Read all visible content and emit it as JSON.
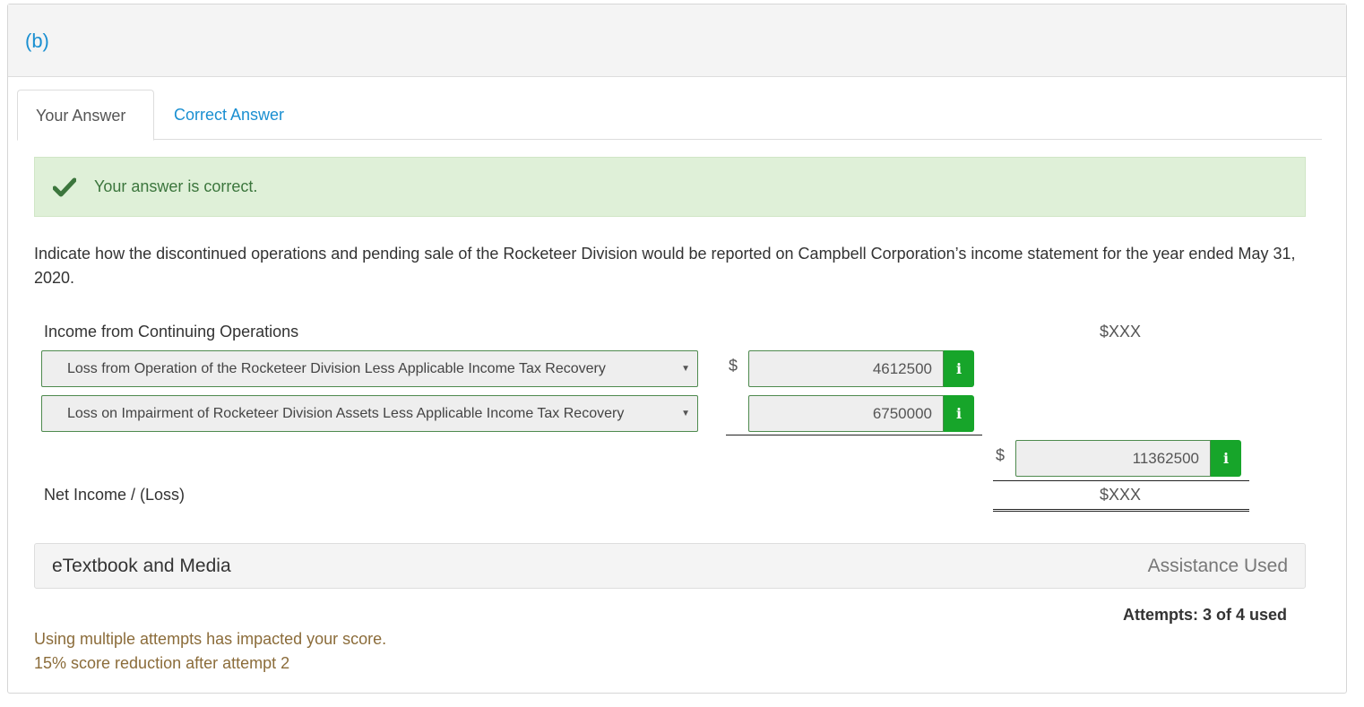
{
  "part": {
    "label": "(b)"
  },
  "tabs": [
    {
      "label": "Your Answer",
      "active": true
    },
    {
      "label": "Correct Answer",
      "active": false
    }
  ],
  "feedback": {
    "icon": "checkmark-icon",
    "message": "Your answer is correct.",
    "color": "#3c763d",
    "background": "#dff0d8"
  },
  "question": {
    "text": "Indicate how the discontinued operations and pending sale of the Rocketeer Division would be reported on Campbell Corporation’s income statement for the year ended May 31, 2020."
  },
  "statement": {
    "income_continuing_label": "Income from Continuing Operations",
    "income_continuing_value": "$XXX",
    "rows": [
      {
        "select_value": "Loss from Operation of the Rocketeer Division Less Applicable Income Tax Recovery",
        "currency": "$",
        "amount": "4612500"
      },
      {
        "select_value": "Loss on Impairment of Rocketeer Division Assets Less Applicable Income Tax Recovery",
        "currency": "",
        "amount": "6750000"
      }
    ],
    "total": {
      "currency": "$",
      "amount": "11362500"
    },
    "net_income_label": "Net Income / (Loss)",
    "net_income_value": "$XXX",
    "info_icon_glyph": "i",
    "accent_color": "#17a52a"
  },
  "etextbook": {
    "title": "eTextbook and Media",
    "status": "Assistance Used"
  },
  "attempts": {
    "text": "Attempts: 3 of 4 used"
  },
  "penalty": {
    "line1": "Using multiple attempts has impacted your score.",
    "line2": "15% score reduction after attempt 2"
  },
  "colors": {
    "link": "#1a8fd1",
    "penalty_text": "#8b6c3a"
  }
}
